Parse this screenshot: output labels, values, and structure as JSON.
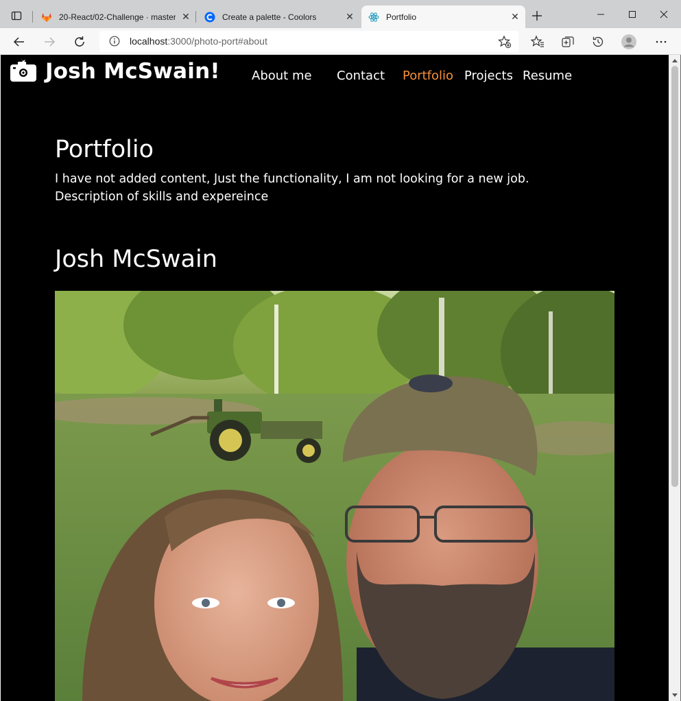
{
  "browser": {
    "tabs": [
      {
        "title": "20-React/02-Challenge · master ·",
        "icon": "gitlab-icon",
        "active": false
      },
      {
        "title": "Create a palette - Coolors",
        "icon": "coolors-icon",
        "active": false
      },
      {
        "title": "Portfolio",
        "icon": "react-icon",
        "active": true
      }
    ],
    "address": {
      "host": "localhost",
      "rest": ":3000/photo-port#about"
    }
  },
  "site": {
    "title": "Josh McSwain!",
    "nav": [
      {
        "label": "About me",
        "active": false
      },
      {
        "label": "Contact",
        "active": false
      },
      {
        "label": "Portfolio",
        "active": true
      },
      {
        "label": "Projects",
        "active": false
      },
      {
        "label": "Resume",
        "active": false
      }
    ],
    "accent_color": "#f7913a",
    "portfolio": {
      "heading": "Portfolio",
      "line1": "I have not added content, Just the functionality, I am not looking for a new job.",
      "line2": "Description of skills and expereince"
    },
    "profile": {
      "heading": "Josh McSwain"
    }
  }
}
